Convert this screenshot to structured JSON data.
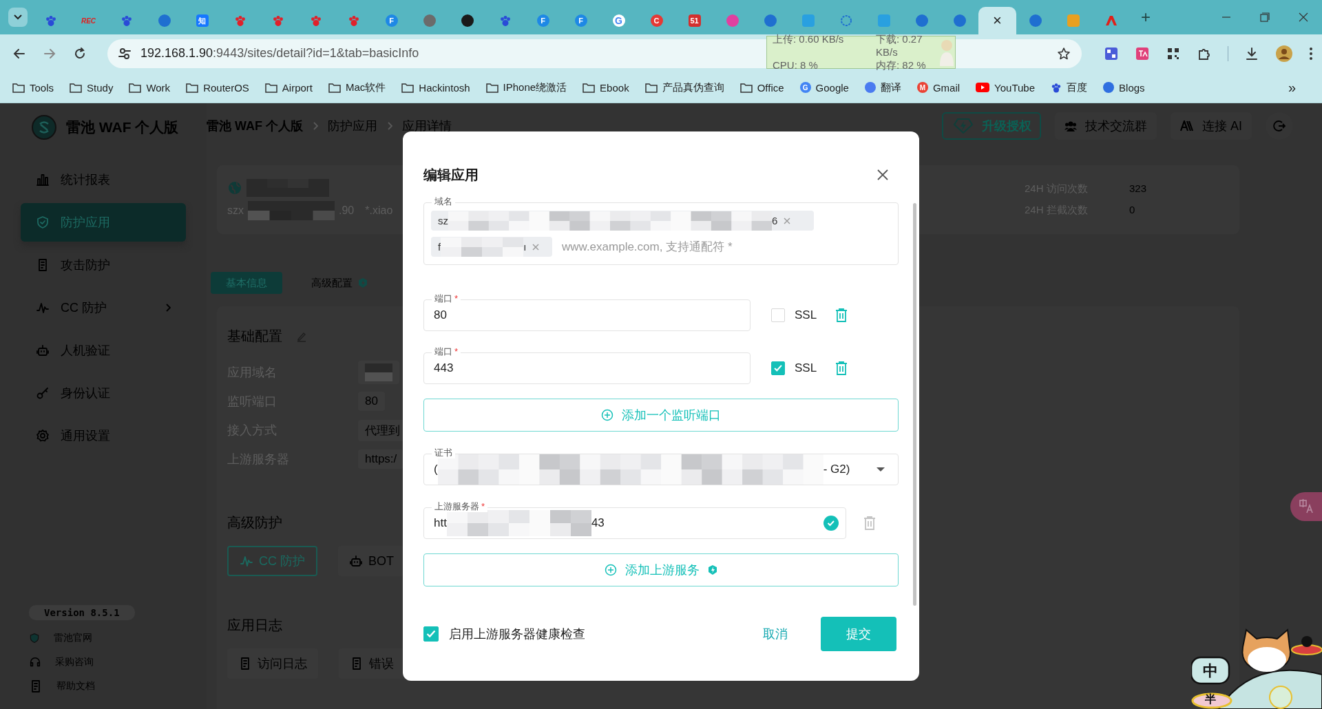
{
  "browser": {
    "tabs": [
      {
        "kind": "flower",
        "color": "#2a4bd7",
        "selected": false
      },
      {
        "kind": "text",
        "glyph": "REC",
        "color": "#e02020",
        "selected": false
      },
      {
        "kind": "flower",
        "color": "#2a4bd7",
        "selected": false
      },
      {
        "kind": "circle",
        "color": "#1f6fd0",
        "selected": false
      },
      {
        "kind": "square",
        "glyph": "知",
        "color": "#1677ff",
        "selected": false
      },
      {
        "kind": "flower",
        "color": "#e0202a",
        "selected": false
      },
      {
        "kind": "flower",
        "color": "#e0202a",
        "selected": false
      },
      {
        "kind": "flower",
        "color": "#e0202a",
        "selected": false
      },
      {
        "kind": "flower",
        "color": "#e0202a",
        "selected": false
      },
      {
        "kind": "circle",
        "glyph": "F",
        "color": "#1e88e5",
        "selected": false
      },
      {
        "kind": "circle",
        "color": "#6b6b6b",
        "selected": false
      },
      {
        "kind": "circle",
        "color": "#1a1a1a",
        "selected": false
      },
      {
        "kind": "flower",
        "color": "#2a4bd7",
        "selected": false
      },
      {
        "kind": "circle",
        "glyph": "F",
        "color": "#1e88e5",
        "selected": false
      },
      {
        "kind": "circle",
        "glyph": "F",
        "color": "#1e88e5",
        "selected": false
      },
      {
        "kind": "circle",
        "glyph": "G",
        "color": "#ffffff",
        "selected": false
      },
      {
        "kind": "circle",
        "glyph": "C",
        "color": "#e53935",
        "selected": false
      },
      {
        "kind": "square",
        "glyph": "51",
        "color": "#d32f2f",
        "selected": false
      },
      {
        "kind": "circle",
        "color": "#e040a0",
        "selected": false
      },
      {
        "kind": "circle",
        "color": "#1f6fd0",
        "selected": false
      },
      {
        "kind": "square",
        "color": "#29a0e0",
        "selected": false
      },
      {
        "kind": "ring",
        "color": "#1f6fd0",
        "selected": false
      },
      {
        "kind": "square",
        "color": "#29a0e0",
        "selected": false
      },
      {
        "kind": "circle",
        "color": "#1f6fd0",
        "selected": false
      },
      {
        "kind": "circle",
        "color": "#1f6fd0",
        "selected": false
      },
      {
        "close": "×",
        "selected": true
      },
      {
        "kind": "circle",
        "color": "#1f6fd0",
        "selected": false
      },
      {
        "kind": "square",
        "color": "#e8a020",
        "selected": false
      },
      {
        "kind": "triangle",
        "color": "#e0201a",
        "selected": false
      }
    ],
    "new_tab": "+",
    "address": {
      "host": "192.168.1.90",
      "rest": ":9443/sites/detail?id=1&tab=basicInfo"
    },
    "net_monitor": {
      "upload": "上传: 0.60 KB/s",
      "download": "下载: 0.27 KB/s",
      "cpu": "CPU: 8 %",
      "memory": "内存: 82 %"
    },
    "bookmarks": [
      {
        "label": "Tools",
        "kind": "folder"
      },
      {
        "label": "Study",
        "kind": "folder"
      },
      {
        "label": "Work",
        "kind": "folder"
      },
      {
        "label": "RouterOS",
        "kind": "folder"
      },
      {
        "label": "Airport",
        "kind": "folder"
      },
      {
        "label": "Mac软件",
        "kind": "folder"
      },
      {
        "label": "Hackintosh",
        "kind": "folder"
      },
      {
        "label": "IPhone绕激活",
        "kind": "folder"
      },
      {
        "label": "Ebook",
        "kind": "folder"
      },
      {
        "label": "产品真伪查询",
        "kind": "folder"
      },
      {
        "label": "Office",
        "kind": "folder"
      },
      {
        "label": "Google",
        "kind": "site",
        "glyph": "G",
        "color": "#4285f4"
      },
      {
        "label": "翻译",
        "kind": "site",
        "color": "#4a7bf0"
      },
      {
        "label": "Gmail",
        "kind": "site",
        "glyph": "M",
        "color": "#ea4335"
      },
      {
        "label": "YouTube",
        "kind": "play",
        "color": "#ff0000"
      },
      {
        "label": "百度",
        "kind": "paw",
        "color": "#2a4bd7"
      },
      {
        "label": "Blogs",
        "kind": "site",
        "color": "#2f6fe0"
      }
    ],
    "more": "»"
  },
  "app": {
    "logo_text": "雷池 WAF 个人版",
    "breadcrumb": [
      "雷池 WAF 个人版",
      "防护应用",
      "应用详情"
    ],
    "header_actions": [
      {
        "kind": "upgrade",
        "label": "升级授权"
      },
      {
        "kind": "group",
        "label": "技术交流群"
      },
      {
        "kind": "ai",
        "label": "连接 AI"
      },
      {
        "kind": "logout"
      }
    ],
    "nav": [
      {
        "label": "统计报表",
        "kind": "chart",
        "selected": false
      },
      {
        "label": "防护应用",
        "kind": "shield",
        "selected": true
      },
      {
        "label": "攻击防护",
        "kind": "doc",
        "selected": false
      },
      {
        "label": "CC 防护",
        "kind": "pulse",
        "selected": false,
        "expandable": true
      },
      {
        "label": "人机验证",
        "kind": "robot",
        "selected": false
      },
      {
        "label": "身份认证",
        "kind": "key",
        "selected": false
      },
      {
        "label": "通用设置",
        "kind": "gear",
        "selected": false
      }
    ],
    "version": "Version 8.5.1",
    "footer_links": [
      {
        "label": "雷池官网",
        "kind": "shield"
      },
      {
        "label": "采购咨询",
        "kind": "headset"
      },
      {
        "label": "帮助文档",
        "kind": "doc"
      }
    ],
    "site_card": {
      "address_start": "szx",
      "address_end": ".90",
      "domain": "*.xiao",
      "stats": [
        {
          "label": "24H 访问次数",
          "value": "323"
        },
        {
          "label": "24H 拦截次数",
          "value": "0"
        }
      ]
    },
    "detail_tabs": [
      {
        "label": "基本信息",
        "selected": true
      },
      {
        "label": "高级配置",
        "selected": false,
        "badge": true
      }
    ],
    "basic": {
      "title": "基础配置",
      "rows": [
        {
          "label": "应用域名",
          "kind": "masked"
        },
        {
          "label": "监听端口",
          "kind": "text",
          "value": "80"
        },
        {
          "label": "接入方式",
          "kind": "text",
          "value": "代理到"
        },
        {
          "label": "上游服务器",
          "kind": "text",
          "value": "https:/"
        }
      ]
    },
    "advanced": {
      "title": "高级防护",
      "buttons": [
        {
          "label": "CC 防护",
          "kind": "pulse",
          "selected": true
        },
        {
          "label": "BOT",
          "kind": "robot",
          "selected": false
        }
      ]
    },
    "logs": {
      "title": "应用日志",
      "buttons": [
        "访问日志",
        "错误"
      ]
    }
  },
  "modal": {
    "title": "编辑应用",
    "domain": {
      "label": "域名",
      "tags": [
        {
          "start": "sz",
          "end": "6"
        },
        {
          "start": "f",
          "end": "ı"
        }
      ],
      "placeholder": "www.example.com, 支持通配符 *"
    },
    "ports": [
      {
        "label": "端口",
        "mark": "*",
        "value": "80",
        "ssl": false,
        "ssl_label": "SSL",
        "can_delete": true
      },
      {
        "label": "端口",
        "mark": "*",
        "value": "443",
        "ssl": true,
        "ssl_label": "SSL",
        "can_delete": true
      }
    ],
    "add_port": "添加一个监听端口",
    "cert": {
      "label": "证书",
      "start": "(",
      "end": "- G2)"
    },
    "upstreams": [
      {
        "label": "上游服务器",
        "mark": "*",
        "start": "htt",
        "end": "43",
        "valid": true,
        "can_delete": false
      }
    ],
    "add_upstream": {
      "label": "添加上游服务",
      "badge": true
    },
    "health_check": {
      "label": "启用上游服务器健康检查",
      "checked": true
    },
    "cancel": "取消",
    "submit": "提交"
  },
  "mascot": {
    "bubble": "中",
    "bowl": "半"
  }
}
